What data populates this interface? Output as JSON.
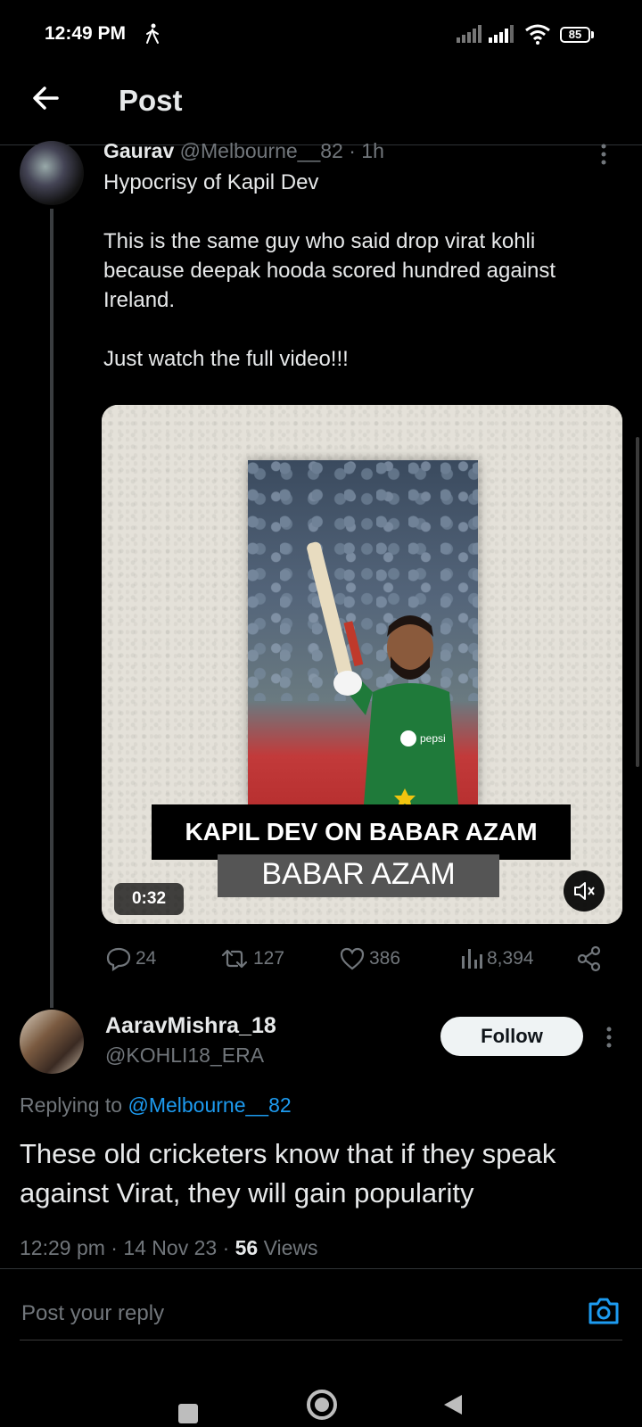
{
  "status_bar": {
    "time": "12:49 PM",
    "battery": "85"
  },
  "header": {
    "title": "Post"
  },
  "quoted_tweet": {
    "name": "Gaurav",
    "handle": "@Melbourne__82 · 1h",
    "text": "Hypocrisy of Kapil Dev\n\nThis is the same guy who said drop virat kohli because deepak hooda scored hundred against Ireland.\n\nJust watch the full video!!!",
    "media": {
      "caption": "KAPIL DEV ON BABAR AZAM",
      "caption2": "BABAR AZAM",
      "duration": "0:32",
      "jersey_text": "pepsi"
    },
    "actions": {
      "replies": "24",
      "reposts": "127",
      "likes": "386",
      "views": "8,394"
    }
  },
  "reply_tweet": {
    "name": "AaravMishra_18",
    "handle": "@KOHLI18_ERA",
    "follow_label": "Follow",
    "replying_prefix": "Replying to",
    "replying_to": "@Melbourne__82",
    "text": "These old cricketers know that if they speak against Virat, they will gain popularity",
    "meta_time": "12:29 pm · 14 Nov 23 · ",
    "meta_views_count": "56",
    "meta_views_label": " Views"
  },
  "reply_box": {
    "placeholder": "Post your reply"
  },
  "colors": {
    "accent": "#1d9bf0",
    "muted": "#71767b",
    "background": "#000000"
  }
}
